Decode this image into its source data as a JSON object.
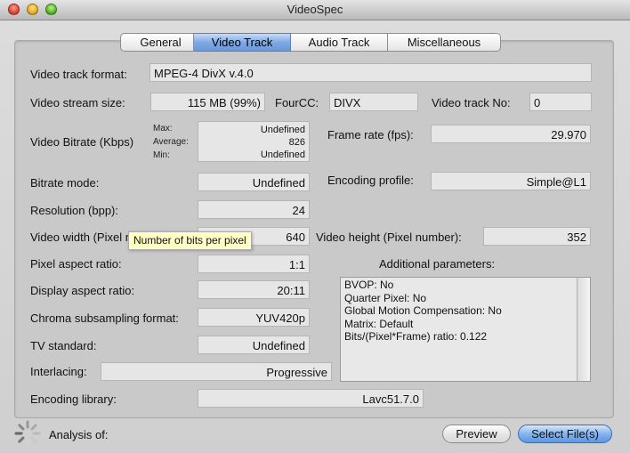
{
  "window": {
    "title": "VideoSpec"
  },
  "tabs": [
    "General",
    "Video Track",
    "Audio Track",
    "Miscellaneous"
  ],
  "active_tab": "Video Track",
  "fields": {
    "video_track_format": {
      "label": "Video track format:",
      "value": "MPEG-4 DivX v.4.0"
    },
    "video_stream_size": {
      "label": "Video stream size:",
      "value": "115 MB (99%)"
    },
    "fourcc": {
      "label": "FourCC:",
      "value": "DIVX"
    },
    "video_track_no": {
      "label": "Video track No:",
      "value": "0"
    },
    "video_bitrate": {
      "label": "Video Bitrate (Kbps)",
      "max_label": "Max:",
      "average_label": "Average:",
      "min_label": "Min:",
      "max": "Undefined",
      "average": "826",
      "min": "Undefined"
    },
    "frame_rate": {
      "label": "Frame rate (fps):",
      "value": "29.970"
    },
    "bitrate_mode": {
      "label": "Bitrate mode:",
      "value": "Undefined"
    },
    "encoding_profile": {
      "label": "Encoding profile:",
      "value": "Simple@L1"
    },
    "resolution": {
      "label": "Resolution (bpp):",
      "value": "24"
    },
    "video_width": {
      "label": "Video width (Pixel number):",
      "value": "640"
    },
    "video_height": {
      "label": "Video height (Pixel number):",
      "value": "352"
    },
    "pixel_aspect_ratio": {
      "label": "Pixel aspect ratio:",
      "value": "1:1"
    },
    "display_aspect_ratio": {
      "label": "Display aspect ratio:",
      "value": "20:11"
    },
    "chroma_subsampling": {
      "label": "Chroma subsampling format:",
      "value": "YUV420p"
    },
    "tv_standard": {
      "label": "TV standard:",
      "value": "Undefined"
    },
    "interlacing": {
      "label": "Interlacing:",
      "value": "Progressive"
    },
    "encoding_library": {
      "label": "Encoding library:",
      "value": "Lavc51.7.0"
    }
  },
  "additional": {
    "label": "Additional parameters:",
    "lines": [
      "BVOP: No",
      "Quarter Pixel: No",
      "Global Motion Compensation: No",
      "Matrix: Default",
      "Bits/(Pixel*Frame) ratio: 0.122"
    ]
  },
  "tooltip": "Number of bits per pixel",
  "footer": {
    "analysis_label": "Analysis of:",
    "preview_button": "Preview",
    "select_button": "Select File(s)"
  },
  "icons": {
    "close": "close-icon",
    "minimize": "minimize-icon",
    "zoom": "zoom-icon",
    "spinner": "spinner-icon"
  },
  "colors": {
    "active_tab": "#7fa9e3",
    "tooltip_bg": "#ffffc6",
    "default_button": "#86b4ec"
  }
}
